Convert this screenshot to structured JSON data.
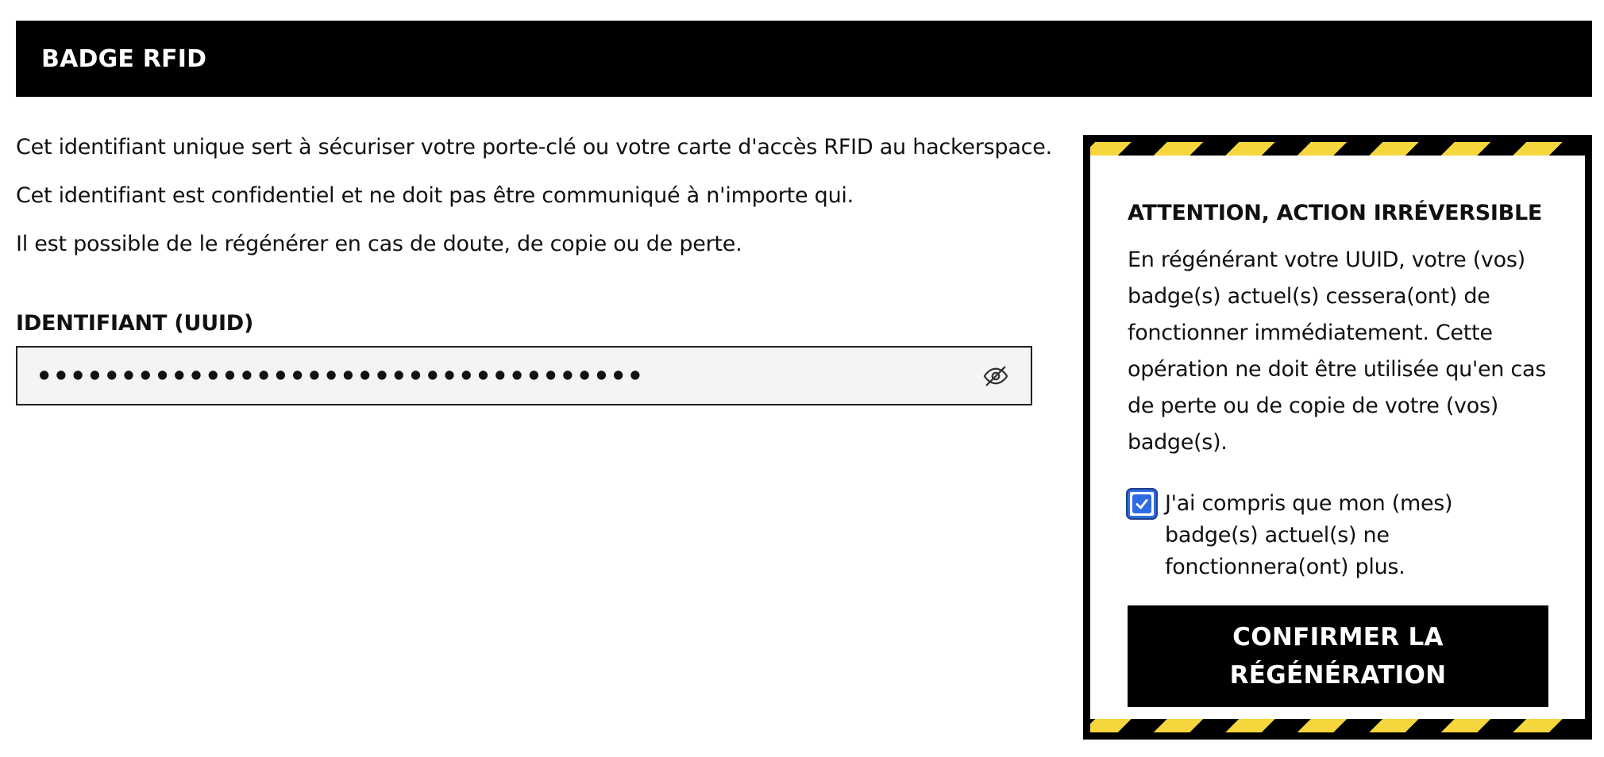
{
  "header": {
    "title": "BADGE RFID"
  },
  "intro": {
    "p1": "Cet identifiant unique sert à sécuriser votre porte-clé ou votre carte d'accès RFID au hackerspace.",
    "p2": "Cet identifiant est confidentiel et ne doit pas être communiqué à n'importe qui.",
    "p3": "Il est possible de le régénérer en cas de doute, de copie ou de perte."
  },
  "uuid": {
    "label": "IDENTIFIANT (UUID)",
    "masked_value": "••••••••••••••••••••••••••••••••••••",
    "toggle_icon": "eye-off-icon"
  },
  "warning": {
    "title": "ATTENTION, ACTION IRRÉVERSIBLE",
    "text": "En régénérant votre UUID, votre (vos) badge(s) actuel(s) cessera(ont) de fonctionner immédiatement. Cette opération ne doit être utilisée qu'en cas de perte ou de copie de votre (vos) badge(s).",
    "ack_label": "J'ai compris que mon (mes) badge(s) actuel(s) ne fonctionnera(ont) plus.",
    "ack_checked": true,
    "confirm_label": "CONFIRMER LA RÉGÉNÉRATION",
    "stripe_colors": [
      "#000000",
      "#f5d63d"
    ]
  },
  "colors": {
    "header_bg": "#000000",
    "accent": "#2e6be6",
    "field_bg": "#f3f4f5"
  }
}
